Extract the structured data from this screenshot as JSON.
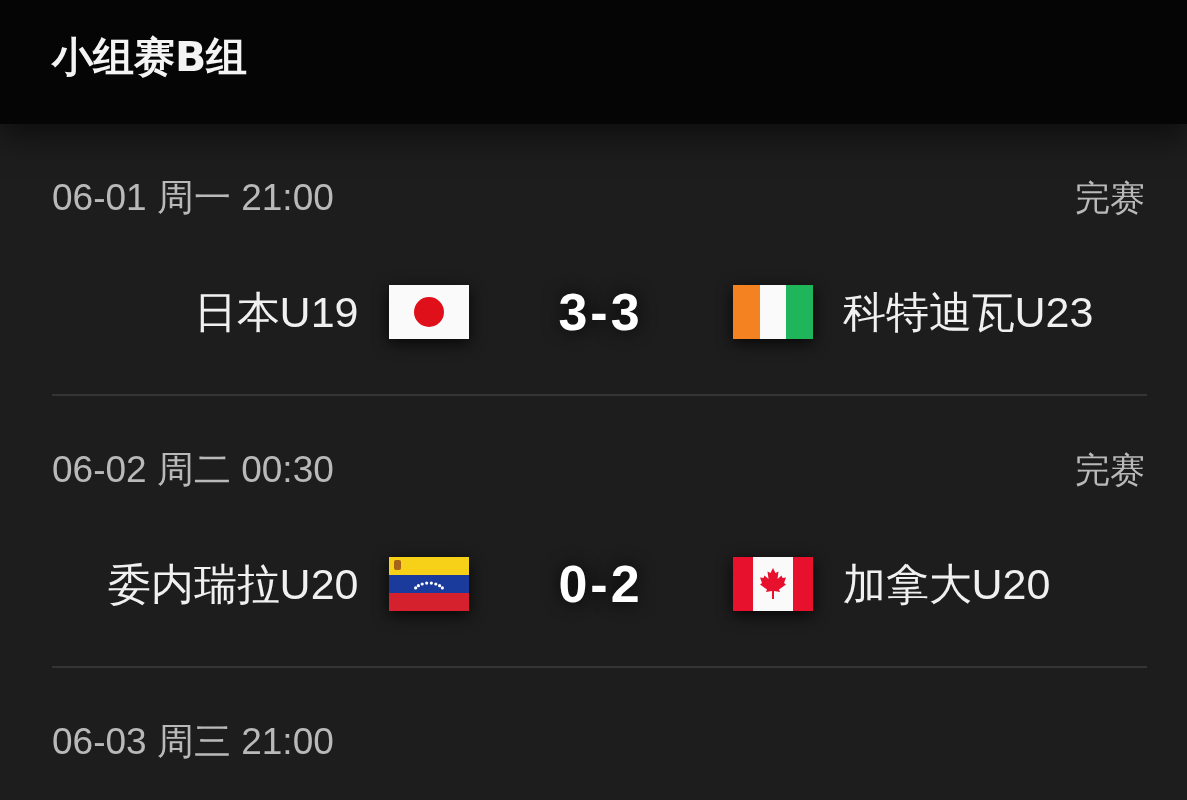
{
  "header": {
    "title": "小组赛B组"
  },
  "matches": [
    {
      "datetime": "06-01 周一 21:00",
      "status": "完赛",
      "home": {
        "name": "日本U19",
        "flag": {
          "kind": "japan"
        }
      },
      "score": "3-3",
      "away": {
        "name": "科特迪瓦U23",
        "flag": {
          "kind": "ivory_coast"
        }
      }
    },
    {
      "datetime": "06-02 周二 00:30",
      "status": "完赛",
      "home": {
        "name": "委内瑞拉U20",
        "flag": {
          "kind": "venezuela"
        }
      },
      "score": "0-2",
      "away": {
        "name": "加拿大U20",
        "flag": {
          "kind": "canada"
        }
      }
    },
    {
      "datetime": "06-03 周三 21:00"
    }
  ]
}
